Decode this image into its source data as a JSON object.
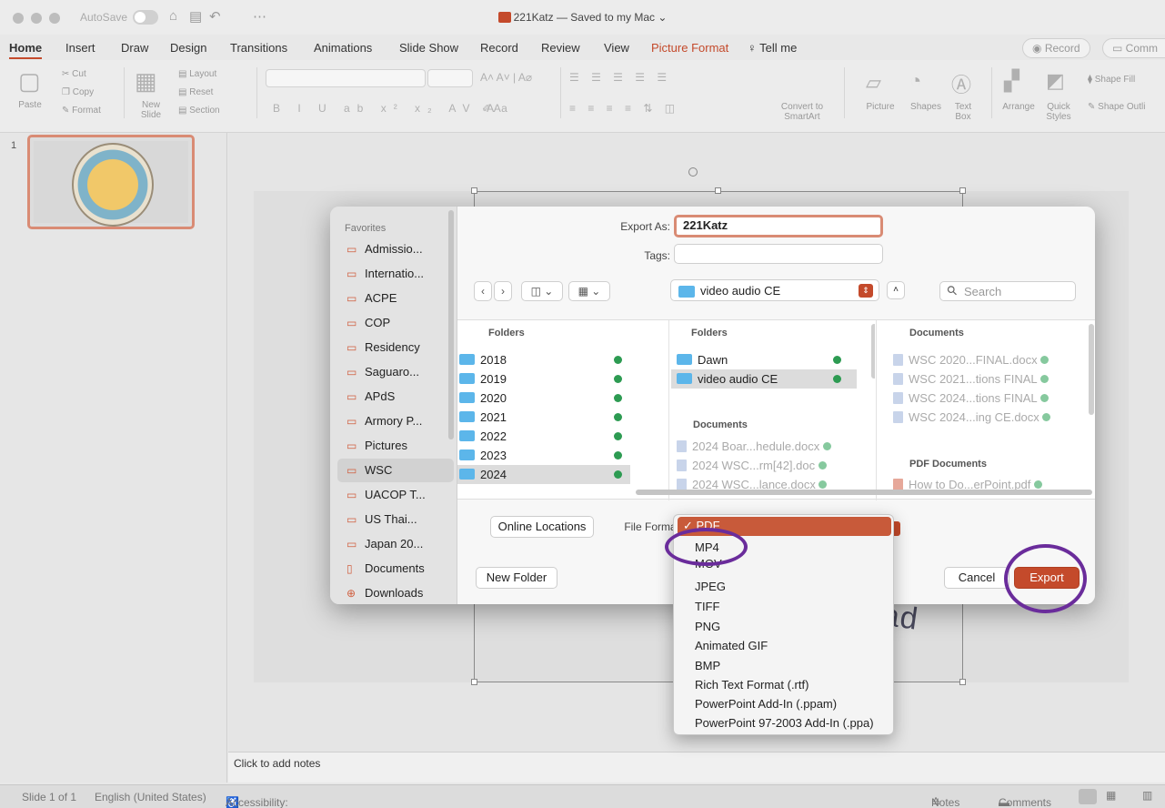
{
  "titlebar": {
    "autosave_label": "AutoSave",
    "doc_title": "221Katz — Saved to my Mac ⌄"
  },
  "tabs": [
    "Home",
    "Insert",
    "Draw",
    "Design",
    "Transitions",
    "Animations",
    "Slide Show",
    "Record",
    "Review",
    "View",
    "Picture Format",
    "Tell me"
  ],
  "record_button": "Record",
  "comments_button": "Comm",
  "ribbon": {
    "paste": "Paste",
    "cut": "Cut",
    "copy": "Copy",
    "format": "Format",
    "new_slide": "New\nSlide",
    "layout": "Layout",
    "reset": "Reset",
    "section": "Section",
    "convert": "Convert to SmartArt",
    "picture": "Picture",
    "shapes": "Shapes",
    "text_box": "Text Box",
    "arrange": "Arrange",
    "quick_styles": "Quick Styles",
    "shape_fill": "Shape Fill",
    "shape_outline": "Shape Outli"
  },
  "thumbnail": {
    "slide_number": "1"
  },
  "slide": {
    "visible_text": "-31 Parad"
  },
  "notes_placeholder": "Click to add notes",
  "status": {
    "slide_count": "Slide 1 of 1",
    "language": "English (United States)",
    "accessibility": "Accessibility: Good to go",
    "notes": "Notes",
    "comments": "Comments"
  },
  "dialog": {
    "export_as_label": "Export As:",
    "export_as_value": "221Katz",
    "tags_label": "Tags:",
    "location": "video audio CE",
    "search_placeholder": "Search",
    "favorites_heading": "Favorites",
    "favorites": [
      "Admissio...",
      "Internatio...",
      "ACPE",
      "COP",
      "Residency",
      "Saguaro...",
      "APdS",
      "Armory P...",
      "Pictures",
      "WSC",
      "UACOP T...",
      "US Thai...",
      "Japan 20...",
      "Documents",
      "Downloads"
    ],
    "col1": {
      "heading": "Folders",
      "items": [
        "2018",
        "2019",
        "2020",
        "2021",
        "2022",
        "2023",
        "2024"
      ]
    },
    "col2": {
      "heading": "Folders",
      "folders": [
        "Dawn",
        "video audio CE"
      ],
      "docs_heading": "Documents",
      "docs": [
        "2024 Boar...hedule.docx",
        "2024 WSC...rm[42].doc",
        "2024 WSC...lance.docx"
      ]
    },
    "col3": {
      "heading": "Documents",
      "docs": [
        "WSC 2020...FINAL.docx",
        "WSC 2021...tions FINAL",
        "WSC 2024...tions FINAL",
        "WSC 2024...ing CE.docx"
      ],
      "pdf_heading": "PDF Documents",
      "pdfs": [
        "How to Do...erPoint.pdf"
      ]
    },
    "online_locations": "Online Locations",
    "file_format_label": "File Format",
    "new_folder": "New Folder",
    "cancel": "Cancel",
    "export": "Export"
  },
  "format_menu": {
    "selected": "PDF",
    "items": [
      "MP4",
      "MOV",
      "JPEG",
      "TIFF",
      "PNG",
      "Animated GIF",
      "BMP",
      "Rich Text Format (.rtf)",
      "PowerPoint Add-In (.ppam)",
      "PowerPoint 97-2003 Add-In (.ppa)"
    ]
  },
  "colors": {
    "accent": "#c44a2b",
    "annotation": "#6a2c9b",
    "folder": "#5cb6ea"
  }
}
